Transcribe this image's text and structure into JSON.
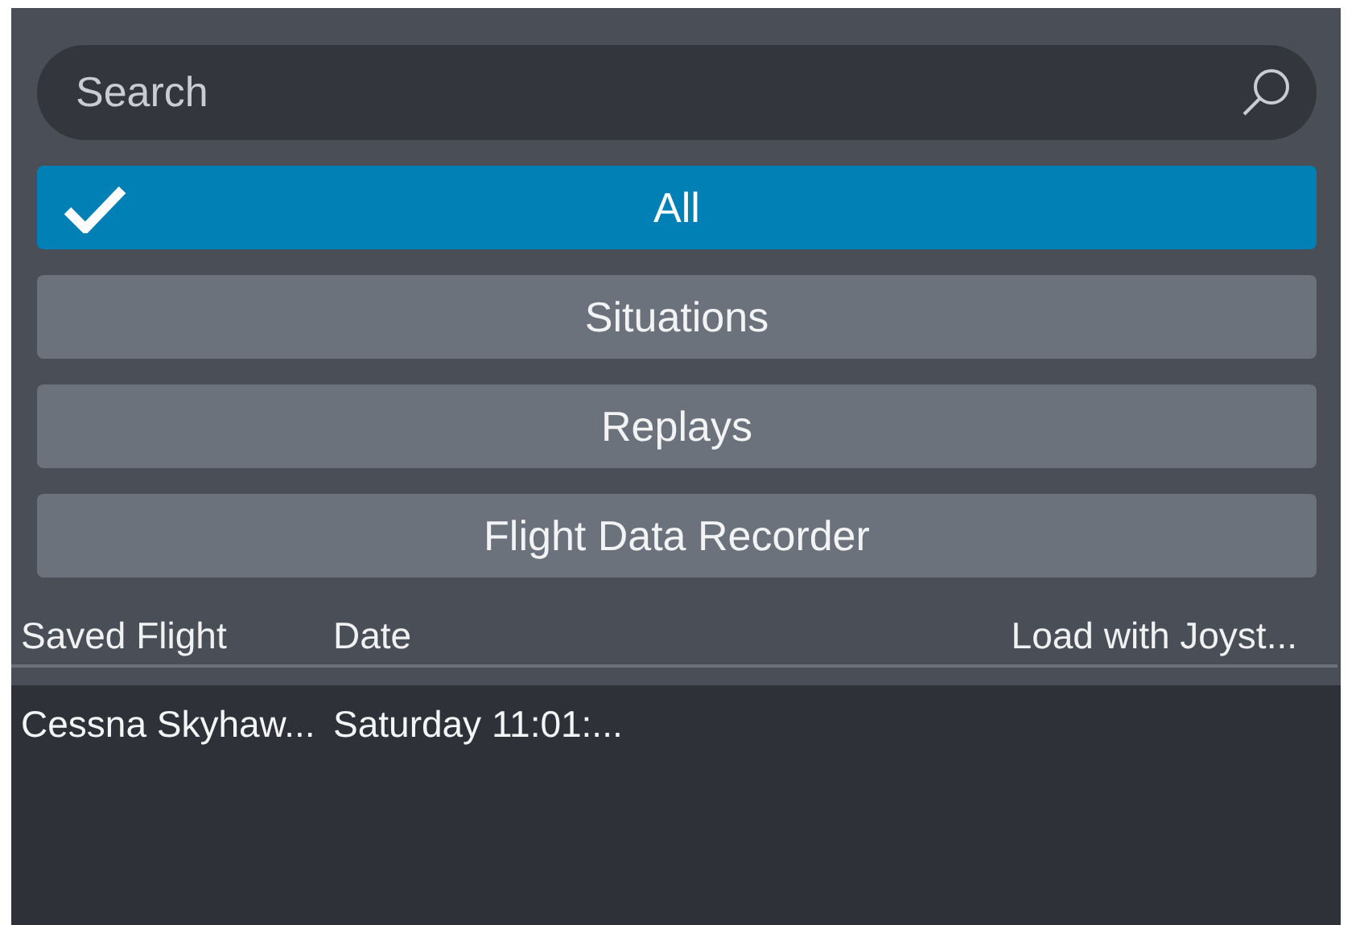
{
  "search": {
    "placeholder": "Search"
  },
  "filters": [
    {
      "label": "All",
      "selected": true
    },
    {
      "label": "Situations",
      "selected": false
    },
    {
      "label": "Replays",
      "selected": false
    },
    {
      "label": "Flight Data Recorder",
      "selected": false
    }
  ],
  "table": {
    "columns": [
      "Saved Flight",
      "Date",
      "Load with Joyst..."
    ],
    "rows": [
      {
        "cells": [
          "Cessna Skyhaw...",
          "Saturday 11:01:..."
        ]
      }
    ]
  }
}
